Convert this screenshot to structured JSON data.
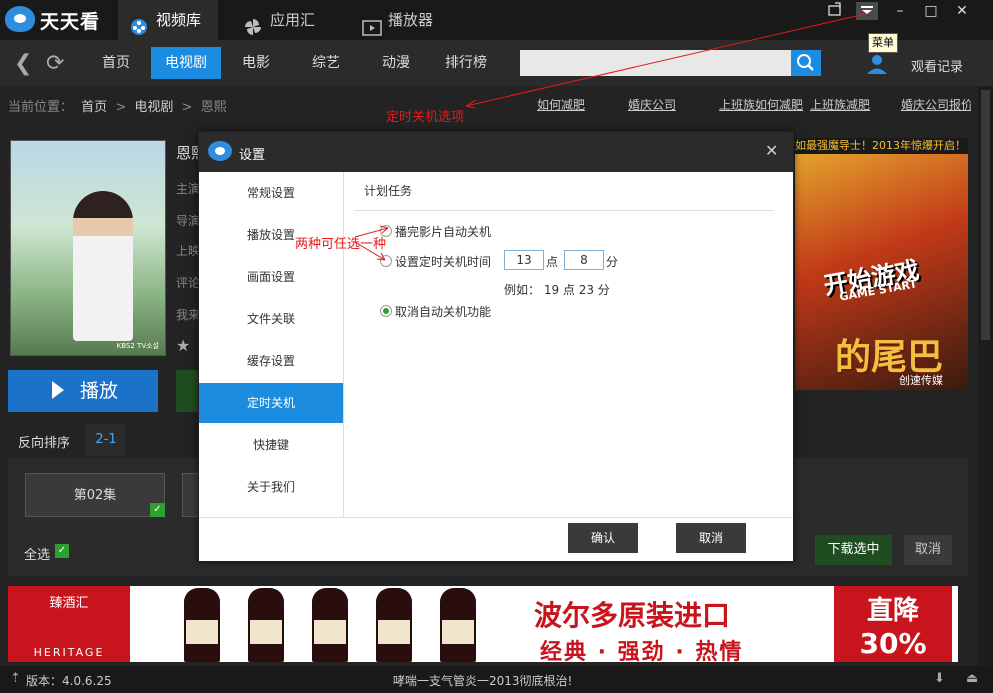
{
  "app": {
    "name": "天天看"
  },
  "top_tabs": [
    {
      "label": "视频库",
      "icon": "video-library-icon"
    },
    {
      "label": "应用汇",
      "icon": "apps-fan-icon"
    },
    {
      "label": "播放器",
      "icon": "player-icon"
    }
  ],
  "menu_tooltip": "菜单",
  "nav": {
    "items": [
      "首页",
      "电视剧",
      "电影",
      "综艺",
      "动漫",
      "排行榜"
    ],
    "active": "电视剧",
    "search_placeholder": "",
    "history": "观看记录"
  },
  "breadcrumb": {
    "prefix": "当前位置：",
    "items": [
      "首页",
      "电视剧",
      "恩熙"
    ],
    "sep": ">"
  },
  "ad_links": [
    "如何减肥",
    "婚庆公司",
    "上班族如何减肥",
    "上班族减肥",
    "婚庆公司报价"
  ],
  "annotations": {
    "shutdown_option": "定时关机选项",
    "choose_one": "两种可任选一种"
  },
  "detail": {
    "title_partial": "恩熙",
    "meta_prefixes": [
      "主演",
      "导演",
      "上映",
      "评论",
      "我来"
    ],
    "poster_caption": "KBS2 TV소설",
    "play_label": "播放"
  },
  "episodes": {
    "sort_label": "反向排序",
    "range_tab": "2-1",
    "items": [
      "第02集"
    ],
    "select_all": "全选",
    "download_selected": "下载选中",
    "cancel": "取消"
  },
  "game_ad": {
    "top": "如最强魔导士！2013年惊爆开启！",
    "title": "开始游戏",
    "sub": "GAME START",
    "big": "的尾巴",
    "brand": "创速传媒"
  },
  "banner": {
    "brand": "臻酒汇",
    "brand_en": "HERITAGE",
    "main": "波尔多原装进口",
    "sub": "经典 · 强劲 · 热情",
    "promo_1": "直降",
    "promo_2": "30%"
  },
  "status": {
    "version": "版本：4.0.6.25",
    "message": "哮喘一支气管炎一2013彻底根治!"
  },
  "dialog": {
    "title": "设置",
    "sidebar": [
      "常规设置",
      "播放设置",
      "画面设置",
      "文件关联",
      "缓存设置",
      "定时关机",
      "快捷键",
      "关于我们"
    ],
    "active": "定时关机",
    "section": "计划任务",
    "option_after_play": "播完影片自动关机",
    "option_timed": "设置定时关机时间",
    "hour_value": "13",
    "hour_unit": "点",
    "minute_value": "8",
    "minute_unit": "分",
    "example": "例如：  19 点 23 分",
    "option_cancel": "取消自动关机功能",
    "confirm": "确认",
    "cancel": "取消"
  },
  "colors": {
    "accent": "#1b8ce0",
    "topbar": "#191919",
    "annotation": "#e21b1b",
    "check": "#2fa02f"
  }
}
